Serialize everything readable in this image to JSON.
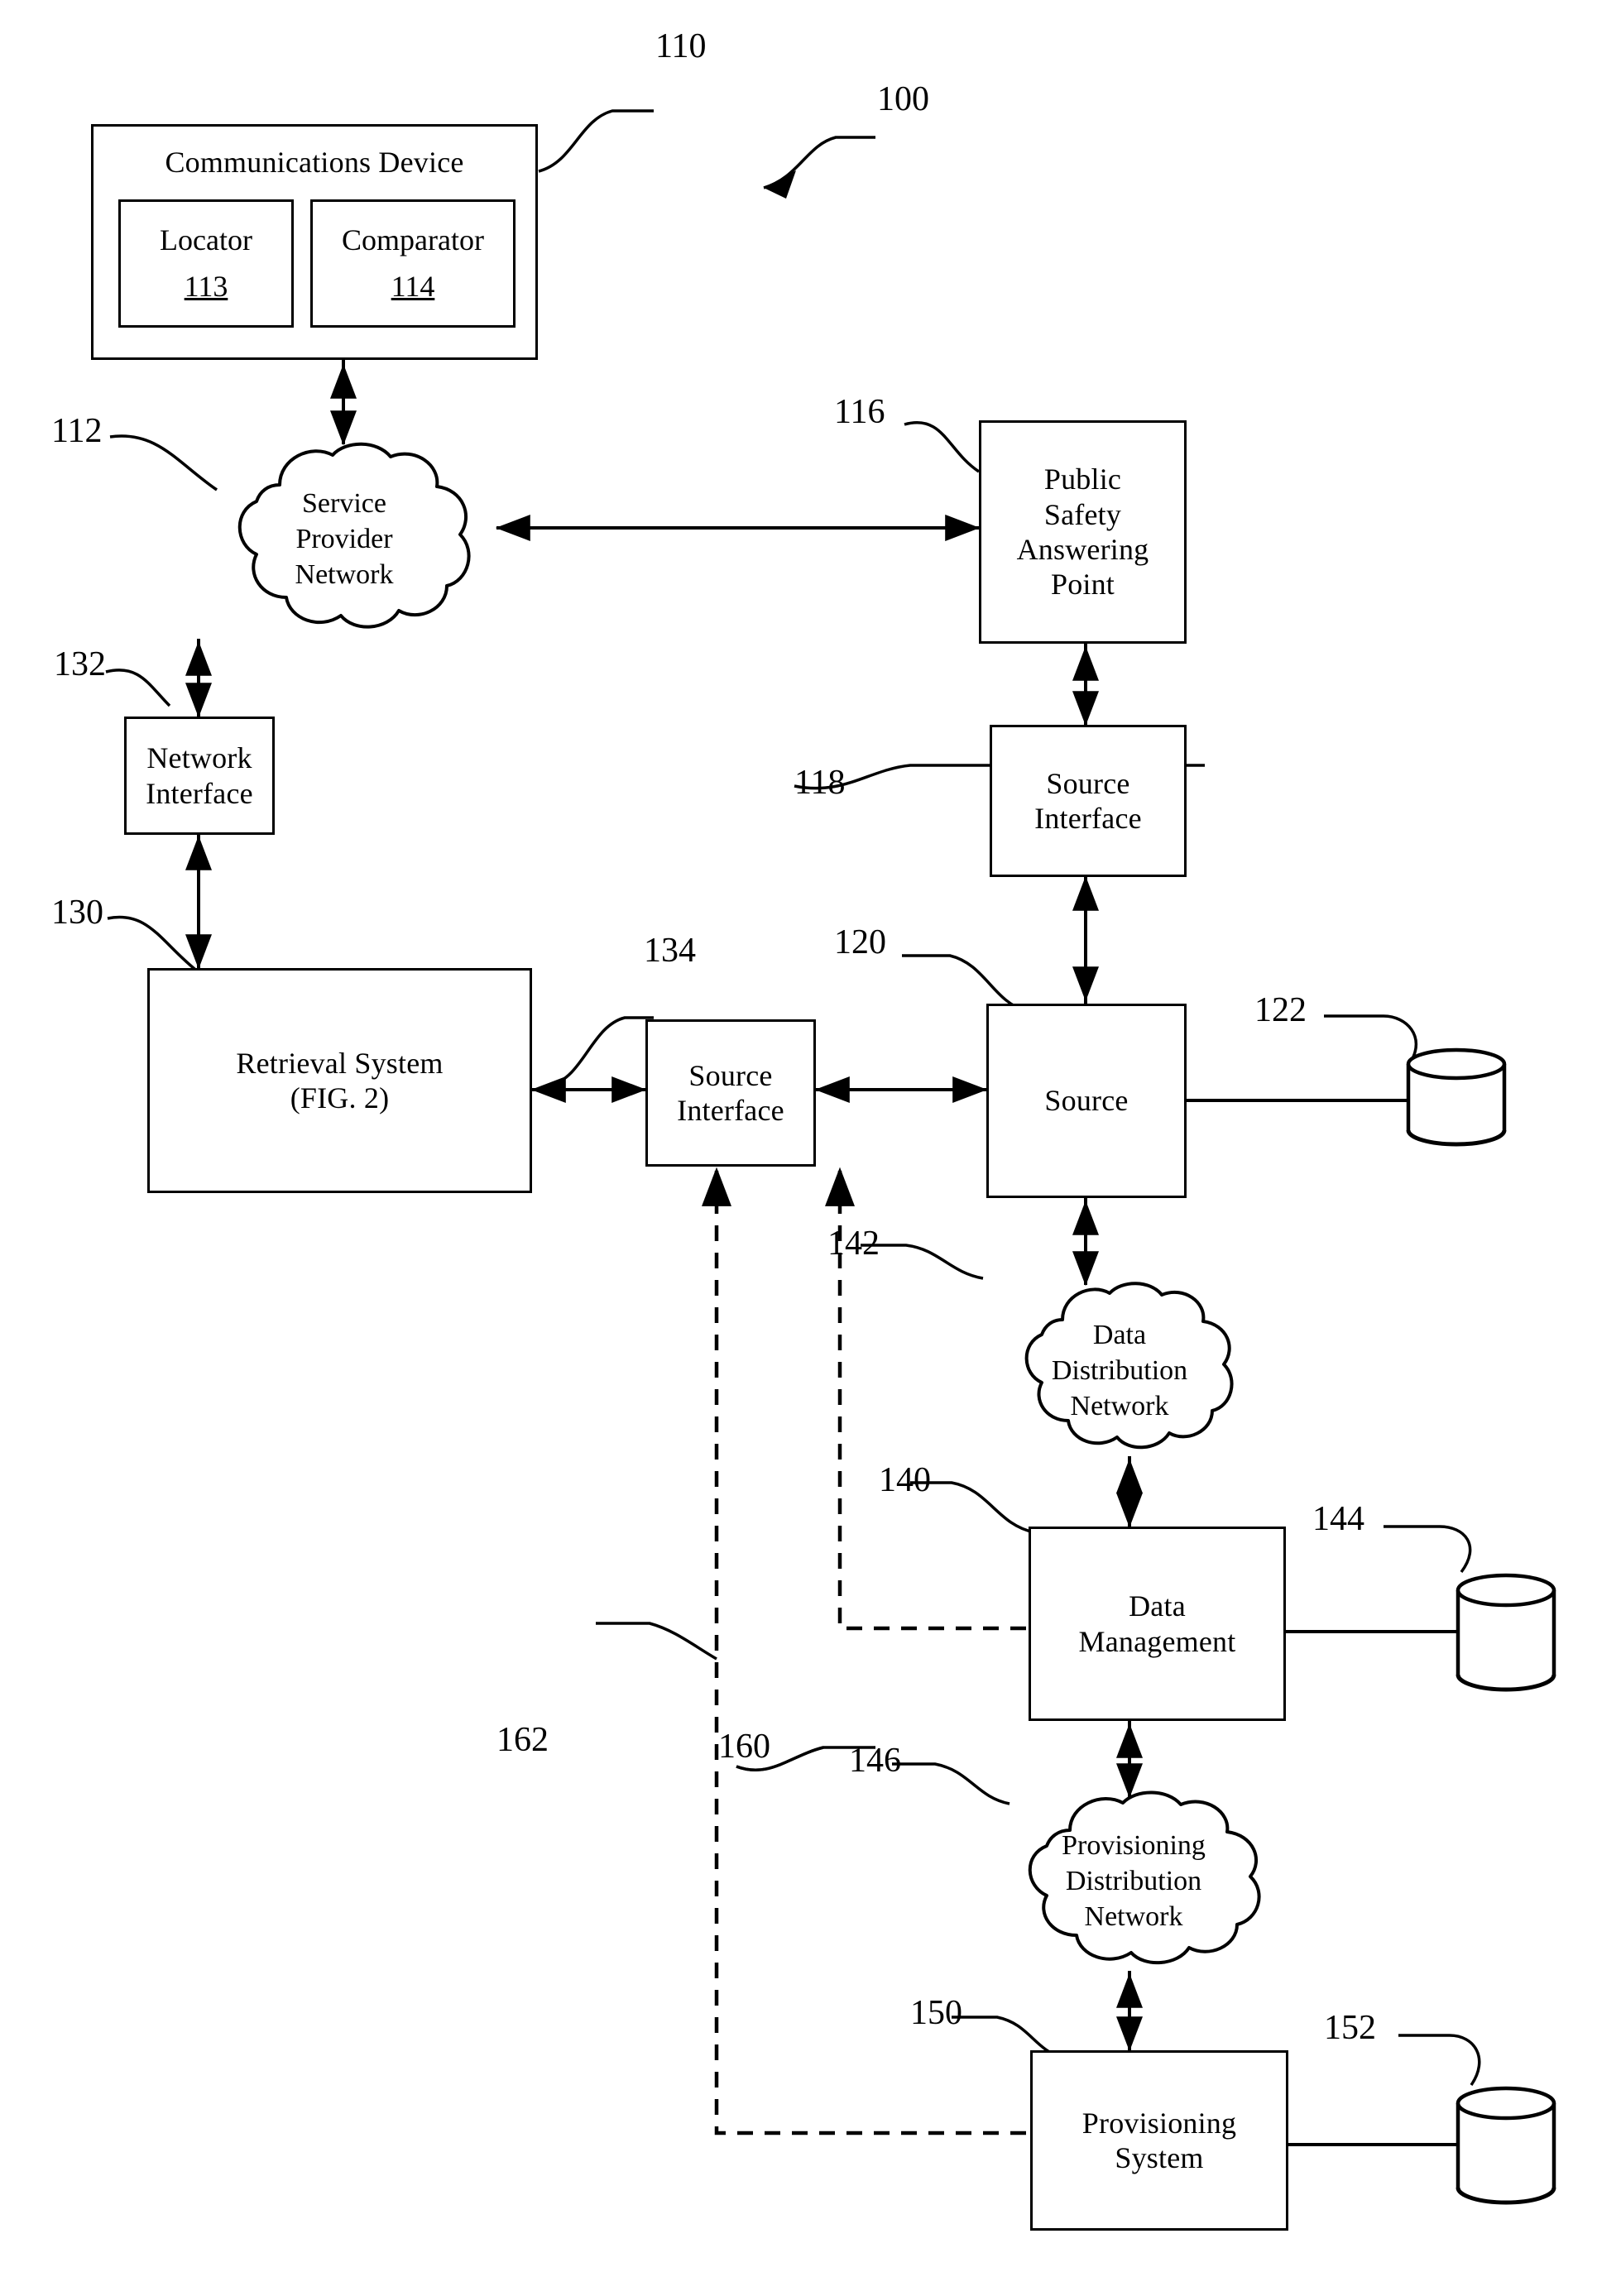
{
  "figure": {
    "title_ref": "100",
    "nodes": {
      "communications_device": {
        "label": "Communications Device",
        "ref": "110",
        "children": [
          {
            "label": "Locator",
            "ref": "113"
          },
          {
            "label": "Comparator",
            "ref": "114"
          }
        ]
      },
      "service_provider_network": {
        "lines": [
          "Service",
          "Provider",
          "Network"
        ],
        "ref": "112"
      },
      "public_safety_answering_point": {
        "lines": [
          "Public",
          "Safety",
          "Answering",
          "Point"
        ],
        "ref": "116"
      },
      "network_interface": {
        "lines": [
          "Network",
          "Interface"
        ],
        "ref": "132"
      },
      "source_interface_psap": {
        "lines": [
          "Source",
          "Interface"
        ],
        "ref": "118"
      },
      "retrieval_system": {
        "lines": [
          "Retrieval System",
          "(FIG. 2)"
        ],
        "ref": "130"
      },
      "source_interface_retrieval": {
        "lines": [
          "Source",
          "Interface"
        ],
        "ref": "134"
      },
      "source": {
        "lines": [
          "Source"
        ],
        "ref": "120"
      },
      "source_database": {
        "ref": "122"
      },
      "data_distribution_network": {
        "lines": [
          "Data",
          "Distribution",
          "Network"
        ],
        "ref": "142"
      },
      "data_management": {
        "lines": [
          "Data",
          "Management"
        ],
        "ref": "140"
      },
      "data_management_database": {
        "ref": "144"
      },
      "provisioning_distribution_network": {
        "lines": [
          "Provisioning",
          "Distribution",
          "Network"
        ],
        "ref": "146"
      },
      "provisioning_system": {
        "lines": [
          "Provisioning",
          "System"
        ],
        "ref": "150"
      },
      "provisioning_system_database": {
        "ref": "152"
      }
    },
    "connector_refs": {
      "data_management_feed": "160",
      "provisioning_system_feed": "162"
    }
  }
}
